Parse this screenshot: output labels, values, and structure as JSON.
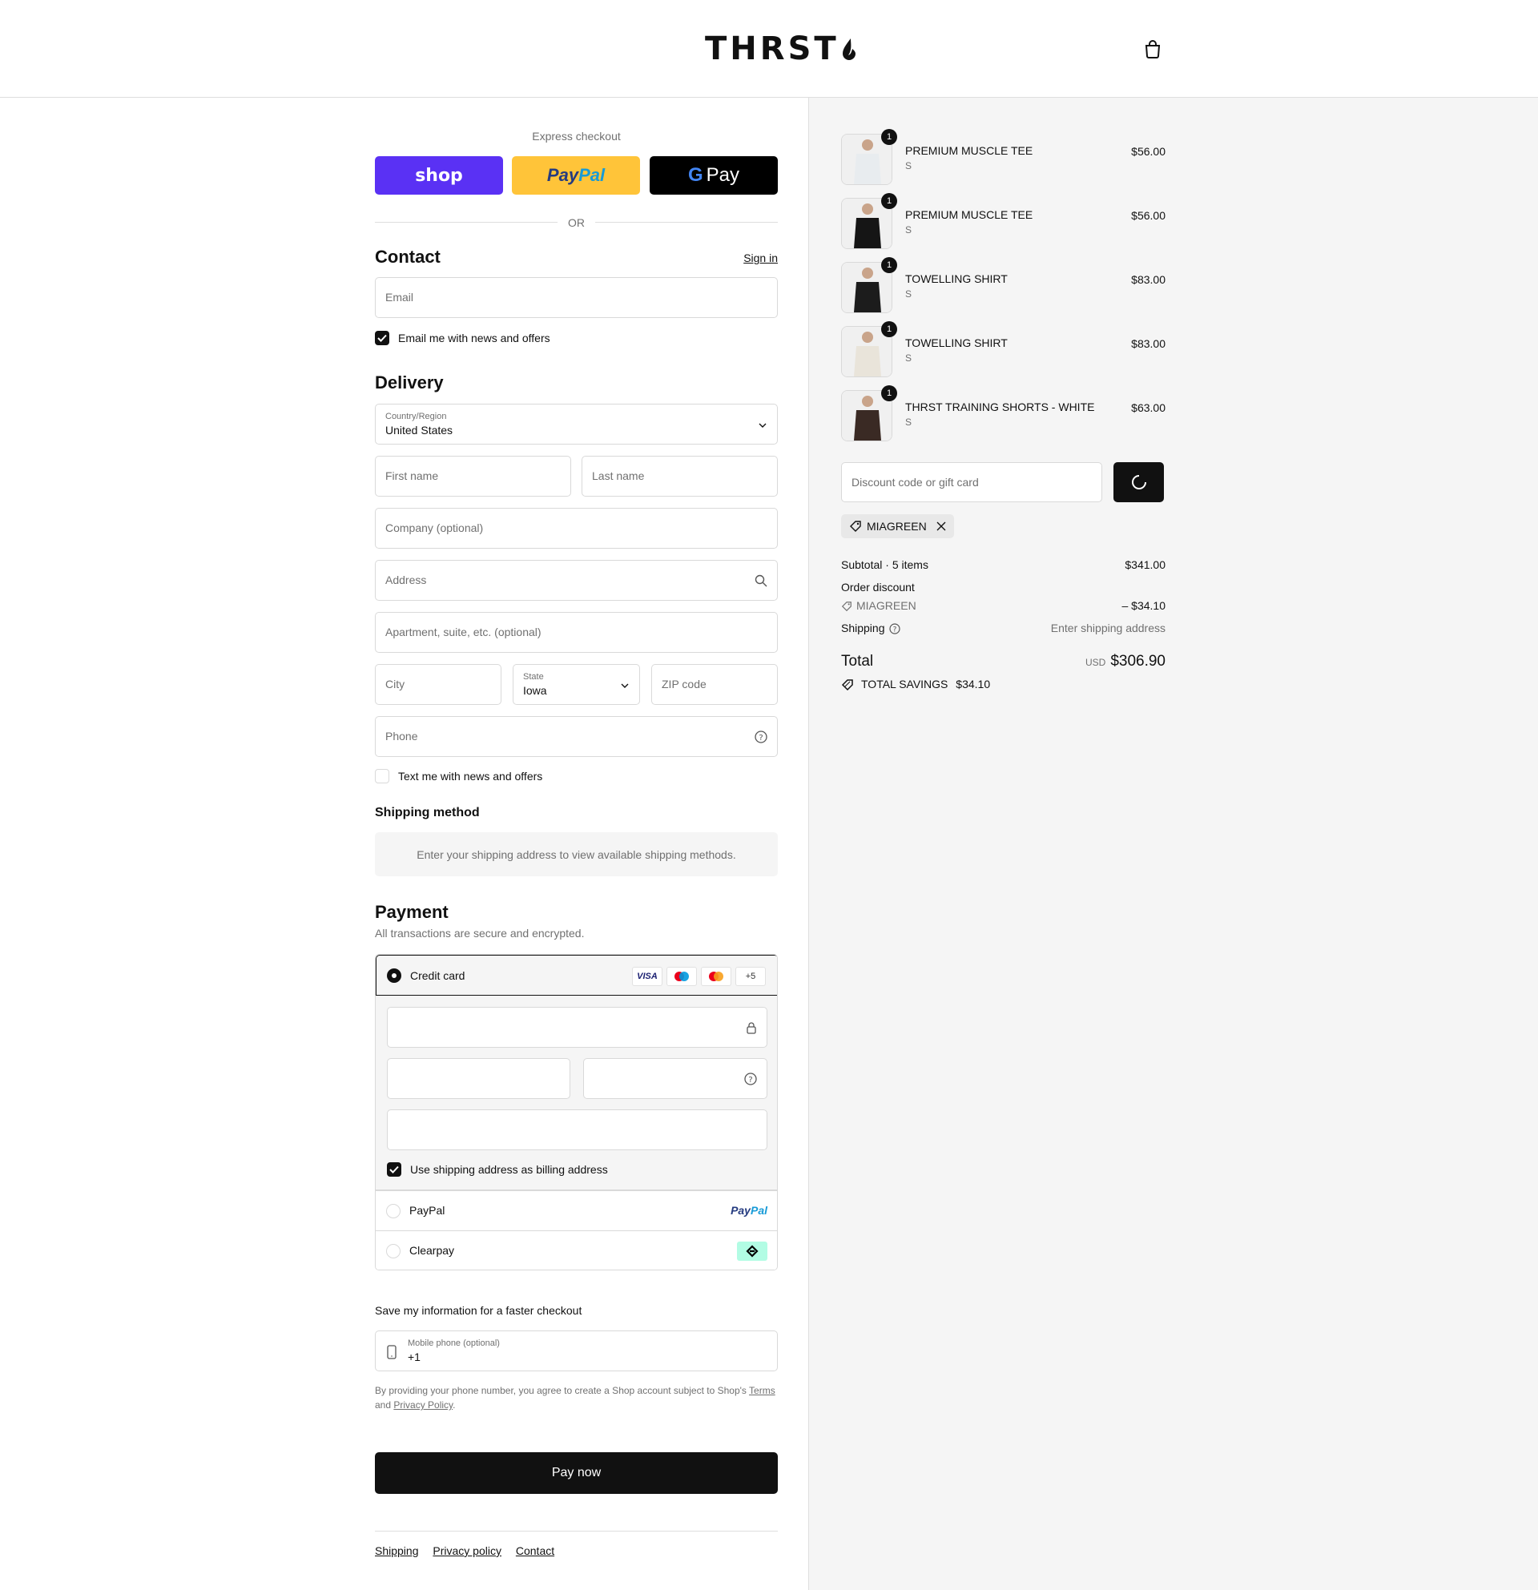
{
  "header": {
    "logo": "THRST",
    "cart_icon": "shopping-bag-icon"
  },
  "express": {
    "title": "Express checkout",
    "shop_label": "shop",
    "paypal_pay": "Pay",
    "paypal_pal": "Pal",
    "gpay_g": "G",
    "gpay_label": "Pay",
    "or": "OR"
  },
  "contact": {
    "title": "Contact",
    "sign_in": "Sign in",
    "email_placeholder": "Email",
    "news_label": "Email me with news and offers",
    "news_checked": true
  },
  "delivery": {
    "title": "Delivery",
    "country_label": "Country/Region",
    "country_value": "United States",
    "first_name": "First name",
    "last_name": "Last name",
    "company": "Company (optional)",
    "address": "Address",
    "apartment": "Apartment, suite, etc. (optional)",
    "city": "City",
    "state_label": "State",
    "state_value": "Iowa",
    "zip": "ZIP code",
    "phone": "Phone",
    "sms_label": "Text me with news and offers",
    "sms_checked": false
  },
  "shipping_method": {
    "title": "Shipping method",
    "note": "Enter your shipping address to view available shipping methods."
  },
  "payment": {
    "title": "Payment",
    "subtitle": "All transactions are secure and encrypted.",
    "credit_card": "Credit card",
    "card_logos": [
      "VISA",
      "maestro",
      "mastercard"
    ],
    "more": "+5",
    "billing_label": "Use shipping address as billing address",
    "paypal": "PayPal",
    "paypal_logo_pay": "Pay",
    "paypal_logo_pal": "Pal",
    "clearpay": "Clearpay"
  },
  "save_info": {
    "title": "Save my information for a faster checkout",
    "mobile_label": "Mobile phone (optional)",
    "mobile_value": "+1",
    "legal_1": "By providing your phone number, you agree to create a Shop account subject to Shop's ",
    "terms": "Terms",
    "legal_2": "and ",
    "privacy": "Privacy Policy",
    "legal_3": "."
  },
  "pay_now": "Pay now",
  "footer": {
    "shipping": "Shipping",
    "privacy": "Privacy policy",
    "contact": "Contact"
  },
  "cart": {
    "items": [
      {
        "name": "PREMIUM MUSCLE TEE",
        "variant": "S",
        "price": "$56.00",
        "qty": "1",
        "color": "#e8ecef"
      },
      {
        "name": "PREMIUM MUSCLE TEE",
        "variant": "S",
        "price": "$56.00",
        "qty": "1",
        "color": "#151515"
      },
      {
        "name": "TOWELLING SHIRT",
        "variant": "S",
        "price": "$83.00",
        "qty": "1",
        "color": "#1c1c1c"
      },
      {
        "name": "TOWELLING SHIRT",
        "variant": "S",
        "price": "$83.00",
        "qty": "1",
        "color": "#e9e4da"
      },
      {
        "name": "THRST TRAINING SHORTS - WHITE",
        "variant": "S",
        "price": "$63.00",
        "qty": "1",
        "color": "#3a2a24"
      }
    ],
    "discount_placeholder": "Discount code or gift card",
    "applied_code": "MIAGREEN",
    "subtotal_label": "Subtotal · 5 items",
    "subtotal_value": "$341.00",
    "order_discount": "Order discount",
    "discount_code": "MIAGREEN",
    "discount_value": "– $34.10",
    "shipping_label": "Shipping",
    "shipping_value": "Enter shipping address",
    "total_label": "Total",
    "currency": "USD",
    "total_value": "$306.90",
    "savings_label": "TOTAL SAVINGS",
    "savings_value": "$34.10"
  }
}
